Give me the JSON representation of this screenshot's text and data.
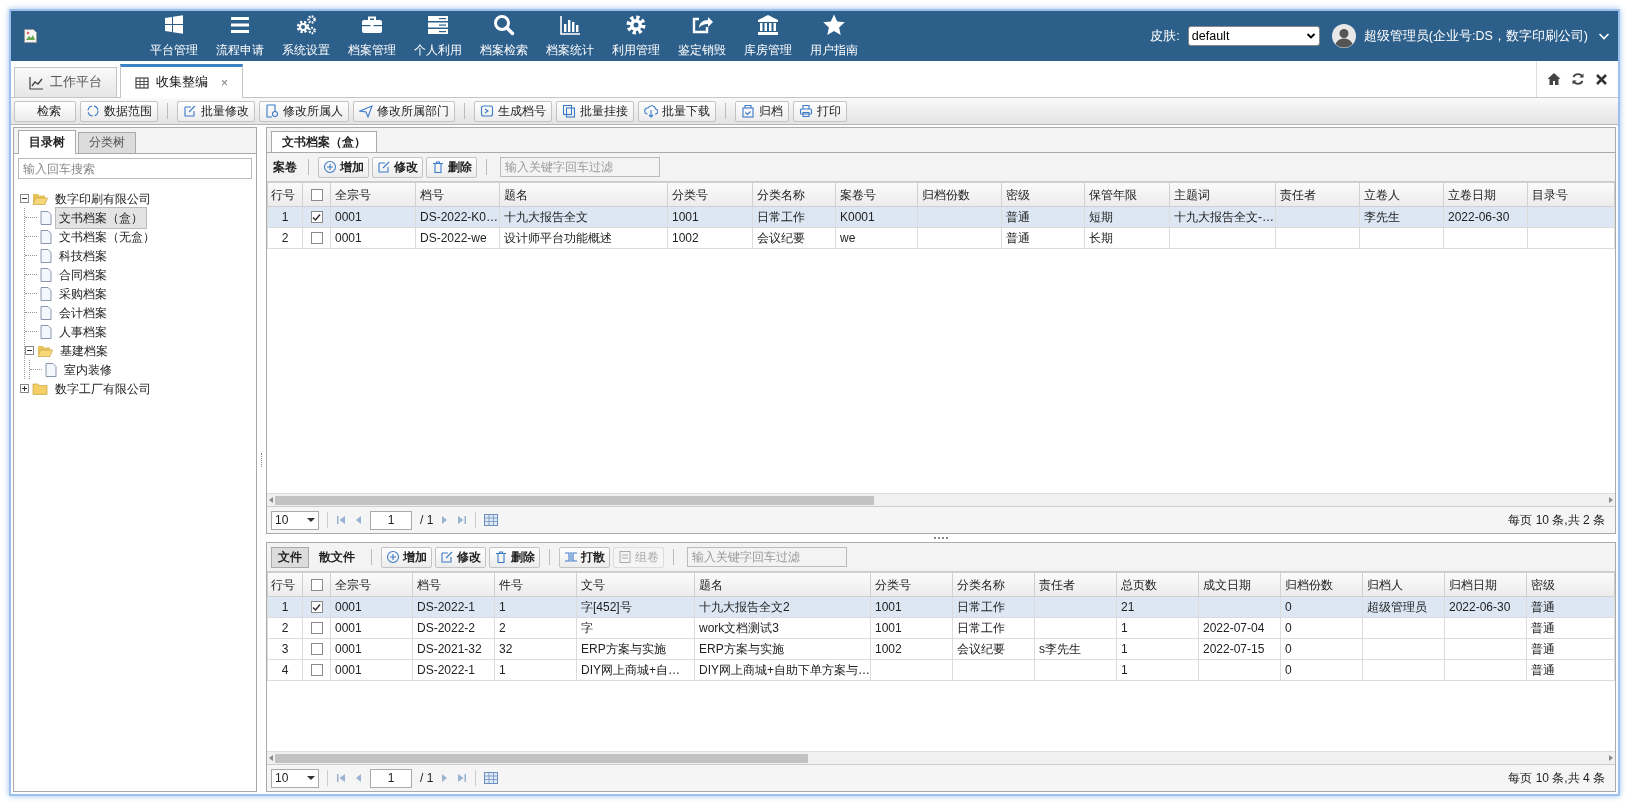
{
  "header": {
    "nav": [
      {
        "label": "平台管理"
      },
      {
        "label": "流程申请"
      },
      {
        "label": "系统设置"
      },
      {
        "label": "档案管理"
      },
      {
        "label": "个人利用"
      },
      {
        "label": "档案检索"
      },
      {
        "label": "档案统计"
      },
      {
        "label": "利用管理"
      },
      {
        "label": "鉴定销毁"
      },
      {
        "label": "库房管理"
      },
      {
        "label": "用户指南"
      }
    ],
    "skin": {
      "label": "皮肤:",
      "value": "default"
    },
    "user": "超级管理员(企业号:DS，数字印刷公司)"
  },
  "tabs": [
    {
      "label": "工作平台",
      "selected": false
    },
    {
      "label": "收集整编",
      "selected": true,
      "close": "×"
    }
  ],
  "toolbar": [
    [
      "检索",
      "数据范围"
    ],
    [
      "批量修改",
      "修改所属人",
      "修改所属部门"
    ],
    [
      "生成档号",
      "批量挂接",
      "批量下载"
    ],
    [
      "归档",
      "打印"
    ]
  ],
  "left_panel": {
    "tabs": [
      {
        "label": "目录树",
        "selected": true
      },
      {
        "label": "分类树",
        "selected": false
      }
    ],
    "search": {
      "placeholder": "输入回车搜索"
    },
    "tree": [
      {
        "label": "数字印刷有限公司",
        "selected": false,
        "expanded": true,
        "children": [
          {
            "label": "文书档案（盒）",
            "selected": true
          },
          {
            "label": "文书档案（无盒）",
            "selected": false
          },
          {
            "label": "科技档案",
            "selected": false
          },
          {
            "label": "合同档案",
            "selected": false
          },
          {
            "label": "采购档案",
            "selected": false
          },
          {
            "label": "会计档案",
            "selected": false
          },
          {
            "label": "人事档案",
            "selected": false
          },
          {
            "label": "基建档案",
            "selected": false,
            "expanded": true,
            "children": [
              {
                "label": "室内装修",
                "selected": false
              }
            ]
          }
        ]
      },
      {
        "label": "数字工厂有限公司",
        "selected": false,
        "expanded": false
      }
    ]
  },
  "panel_tab": {
    "label": "文书档案（盒）",
    "selected": true
  },
  "upper": {
    "title": "案卷",
    "buttons": [
      "增加",
      "修改",
      "删除"
    ],
    "filter": {
      "placeholder": "输入关键字回车过滤"
    },
    "table": {
      "all_checked": false,
      "columns": [
        "行号",
        "",
        "全宗号",
        "档号",
        "题名",
        "分类号",
        "分类名称",
        "案卷号",
        "归档份数",
        "密级",
        "保管年限",
        "主题词",
        "责任者",
        "立卷人",
        "立卷日期",
        "目录号"
      ],
      "rows": [
        {
          "checked": true,
          "selected": true,
          "cells": [
            "1",
            null,
            "0001",
            "DS-2022-K0…",
            "十九大报告全文",
            "1001",
            "日常工作",
            "K0001",
            null,
            "普通",
            "短期",
            "十九大报告全文-…",
            null,
            "李先生",
            "2022-06-30",
            null
          ]
        },
        {
          "checked": false,
          "selected": false,
          "cells": [
            "2",
            null,
            "0001",
            "DS-2022-we",
            "设计师平台功能概述",
            "1002",
            "会议纪要",
            "we",
            null,
            "普通",
            "长期",
            null,
            null,
            null,
            null,
            null
          ]
        }
      ]
    },
    "pager": {
      "size": "10",
      "page": "1",
      "pages": "/ 1",
      "summary": "每页 10 条,共 2 条"
    }
  },
  "lower": {
    "tabs": [
      {
        "label": "文件",
        "selected": true
      },
      {
        "label": "散文件",
        "selected": false
      }
    ],
    "buttons": [
      [
        {
          "label": "增加",
          "disabled": false
        },
        {
          "label": "修改",
          "disabled": false
        },
        {
          "label": "删除",
          "disabled": false
        }
      ],
      [
        {
          "label": "打散",
          "disabled": false
        },
        {
          "label": "组卷",
          "disabled": true
        }
      ]
    ],
    "filter": {
      "placeholder": "输入关键字回车过滤"
    },
    "table": {
      "all_checked": false,
      "columns": [
        "行号",
        "",
        "全宗号",
        "档号",
        "件号",
        "文号",
        "题名",
        "分类号",
        "分类名称",
        "责任者",
        "总页数",
        "成文日期",
        "归档份数",
        "归档人",
        "归档日期",
        "密级"
      ],
      "rows": [
        {
          "checked": true,
          "selected": true,
          "cells": [
            "1",
            null,
            "0001",
            "DS-2022-1",
            "1",
            "字[452]号",
            "十九大报告全文2",
            "1001",
            "日常工作",
            null,
            "21",
            null,
            "0",
            "超级管理员",
            "2022-06-30",
            "普通"
          ]
        },
        {
          "checked": false,
          "selected": false,
          "cells": [
            "2",
            null,
            "0001",
            "DS-2022-2",
            "2",
            "字",
            "work文档测试3",
            "1001",
            "日常工作",
            null,
            "1",
            "2022-07-04",
            "0",
            null,
            null,
            "普通"
          ]
        },
        {
          "checked": false,
          "selected": false,
          "cells": [
            "3",
            null,
            "0001",
            "DS-2021-32",
            "32",
            "ERP方案与实施",
            "ERP方案与实施",
            "1002",
            "会议纪要",
            "s李先生",
            "1",
            "2022-07-15",
            "0",
            null,
            null,
            "普通"
          ]
        },
        {
          "checked": false,
          "selected": false,
          "cells": [
            "4",
            null,
            "0001",
            "DS-2022-1",
            "1",
            "DIY网上商城+自…",
            "DIY网上商城+自助下单方案与…",
            null,
            null,
            null,
            "1",
            null,
            "0",
            null,
            null,
            "普通"
          ]
        }
      ]
    },
    "pager": {
      "size": "10",
      "page": "1",
      "pages": "/ 1",
      "summary": "每页 10 条,共 4 条"
    }
  }
}
